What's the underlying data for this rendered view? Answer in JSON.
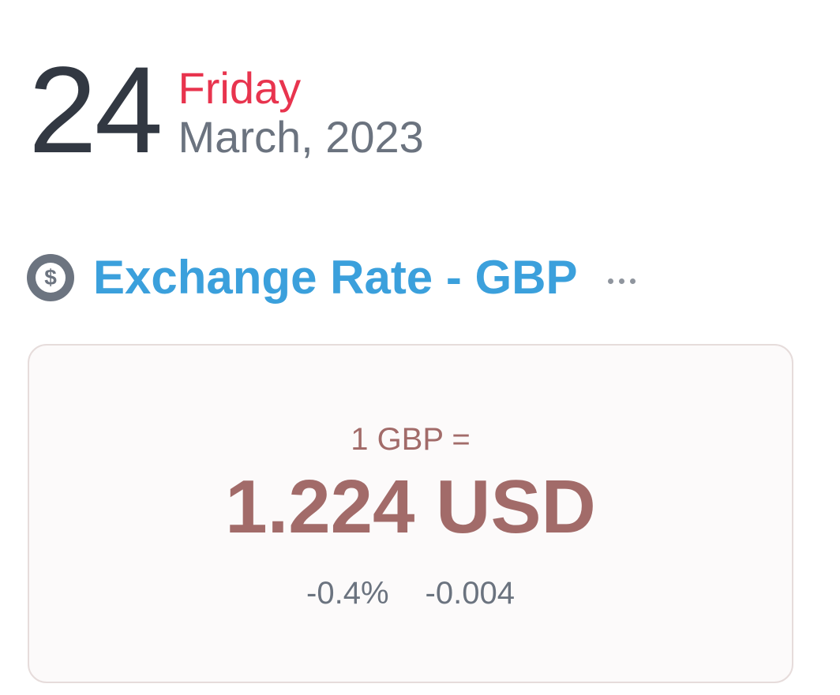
{
  "date": {
    "day": "24",
    "weekday": "Friday",
    "month_year": "March, 2023"
  },
  "widget": {
    "icon": "dollar-circle-icon",
    "title": "Exchange Rate - GBP",
    "more_icon": "more-horizontal-icon"
  },
  "rate": {
    "base": "1 GBP =",
    "value": "1.224 USD",
    "change_percent": "-0.4%",
    "change_abs": "-0.004"
  },
  "colors": {
    "weekday": "#e8344e",
    "title": "#3ba0dc",
    "rate": "#a26b69",
    "muted": "#6b737f",
    "dark": "#323842"
  }
}
